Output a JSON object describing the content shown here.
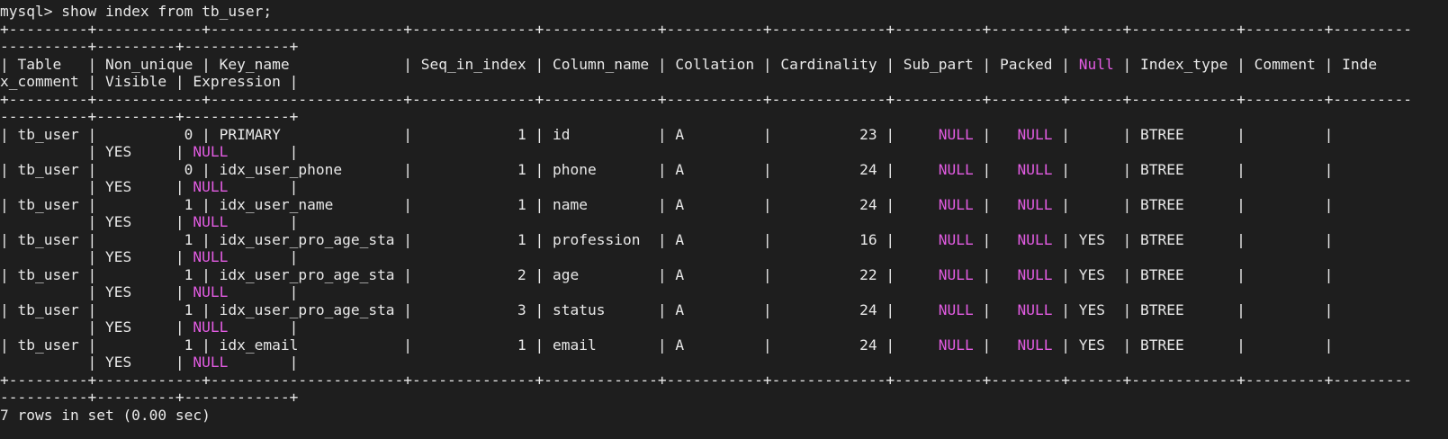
{
  "colors": {
    "background": "#1e1e1e",
    "text": "#e8e8e8",
    "null_highlight": "#e35ce3"
  },
  "terminal": {
    "lines": [
      [
        {
          "text": "mysql> show index from tb_user;"
        }
      ],
      [
        {
          "text": "+---------+------------+----------------------+--------------+-------------+-----------+-------------+----------+--------+------+------------+---------+---------"
        }
      ],
      [
        {
          "text": "----------+---------+------------+"
        }
      ],
      [
        {
          "text": "| Table   | Non_unique | Key_name             | Seq_in_index | Column_name | Collation | Cardinality | Sub_part | Packed | "
        },
        {
          "text": "Null",
          "null": true
        },
        {
          "text": " | Index_type | Comment | Inde"
        }
      ],
      [
        {
          "text": "x_comment | Visible | Expression |"
        }
      ],
      [
        {
          "text": "+---------+------------+----------------------+--------------+-------------+-----------+-------------+----------+--------+------+------------+---------+---------"
        }
      ],
      [
        {
          "text": "----------+---------+------------+"
        }
      ],
      [
        {
          "text": "| tb_user |          0 | PRIMARY              |            1 | id          | A         |          23 |     "
        },
        {
          "text": "NULL",
          "null": true
        },
        {
          "text": " |   "
        },
        {
          "text": "NULL",
          "null": true
        },
        {
          "text": " |      | BTREE      |         |"
        }
      ],
      [
        {
          "text": "          | YES     | "
        },
        {
          "text": "NULL",
          "null": true
        },
        {
          "text": "       |"
        }
      ],
      [
        {
          "text": "| tb_user |          0 | idx_user_phone       |            1 | phone       | A         |          24 |     "
        },
        {
          "text": "NULL",
          "null": true
        },
        {
          "text": " |   "
        },
        {
          "text": "NULL",
          "null": true
        },
        {
          "text": " |      | BTREE      |         |"
        }
      ],
      [
        {
          "text": "          | YES     | "
        },
        {
          "text": "NULL",
          "null": true
        },
        {
          "text": "       |"
        }
      ],
      [
        {
          "text": "| tb_user |          1 | idx_user_name        |            1 | name        | A         |          24 |     "
        },
        {
          "text": "NULL",
          "null": true
        },
        {
          "text": " |   "
        },
        {
          "text": "NULL",
          "null": true
        },
        {
          "text": " |      | BTREE      |         |"
        }
      ],
      [
        {
          "text": "          | YES     | "
        },
        {
          "text": "NULL",
          "null": true
        },
        {
          "text": "       |"
        }
      ],
      [
        {
          "text": "| tb_user |          1 | idx_user_pro_age_sta |            1 | profession  | A         |          16 |     "
        },
        {
          "text": "NULL",
          "null": true
        },
        {
          "text": " |   "
        },
        {
          "text": "NULL",
          "null": true
        },
        {
          "text": " | YES  | BTREE      |         |"
        }
      ],
      [
        {
          "text": "          | YES     | "
        },
        {
          "text": "NULL",
          "null": true
        },
        {
          "text": "       |"
        }
      ],
      [
        {
          "text": "| tb_user |          1 | idx_user_pro_age_sta |            2 | age         | A         |          22 |     "
        },
        {
          "text": "NULL",
          "null": true
        },
        {
          "text": " |   "
        },
        {
          "text": "NULL",
          "null": true
        },
        {
          "text": " | YES  | BTREE      |         |"
        }
      ],
      [
        {
          "text": "          | YES     | "
        },
        {
          "text": "NULL",
          "null": true
        },
        {
          "text": "       |"
        }
      ],
      [
        {
          "text": "| tb_user |          1 | idx_user_pro_age_sta |            3 | status      | A         |          24 |     "
        },
        {
          "text": "NULL",
          "null": true
        },
        {
          "text": " |   "
        },
        {
          "text": "NULL",
          "null": true
        },
        {
          "text": " | YES  | BTREE      |         |"
        }
      ],
      [
        {
          "text": "          | YES     | "
        },
        {
          "text": "NULL",
          "null": true
        },
        {
          "text": "       |"
        }
      ],
      [
        {
          "text": "| tb_user |          1 | idx_email            |            1 | email       | A         |          24 |     "
        },
        {
          "text": "NULL",
          "null": true
        },
        {
          "text": " |   "
        },
        {
          "text": "NULL",
          "null": true
        },
        {
          "text": " | YES  | BTREE      |         |"
        }
      ],
      [
        {
          "text": "          | YES     | "
        },
        {
          "text": "NULL",
          "null": true
        },
        {
          "text": "       |"
        }
      ],
      [
        {
          "text": "+---------+------------+----------------------+--------------+-------------+-----------+-------------+----------+--------+------+------------+---------+---------"
        }
      ],
      [
        {
          "text": "----------+---------+------------+"
        }
      ],
      [
        {
          "text": "7 rows in set (0.00 sec)"
        }
      ]
    ]
  }
}
